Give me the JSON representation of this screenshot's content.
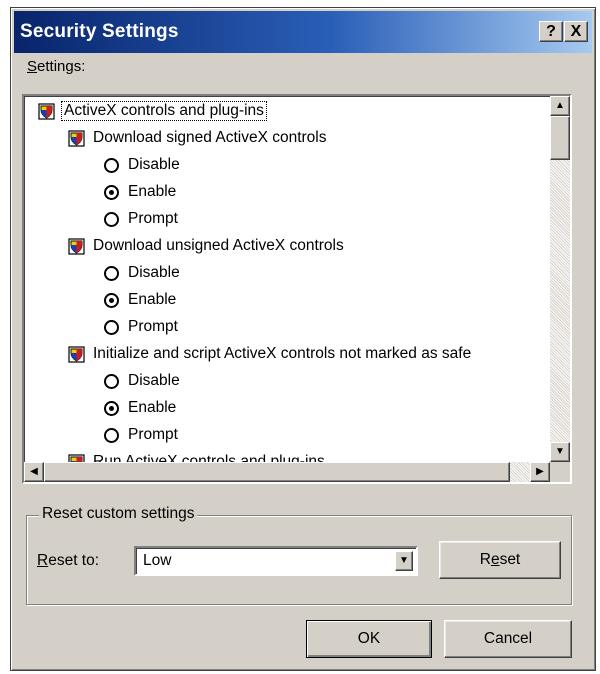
{
  "window": {
    "title": "Security Settings",
    "help_glyph": "?",
    "close_glyph": "X"
  },
  "settings_label_accel": "S",
  "settings_label_rest": "ettings:",
  "tree": {
    "category": "ActiveX controls and plug-ins",
    "items": [
      {
        "label": "Download signed ActiveX controls",
        "options": [
          {
            "label": "Disable",
            "selected": false
          },
          {
            "label": "Enable",
            "selected": true
          },
          {
            "label": "Prompt",
            "selected": false
          }
        ]
      },
      {
        "label": "Download unsigned ActiveX controls",
        "options": [
          {
            "label": "Disable",
            "selected": false
          },
          {
            "label": "Enable",
            "selected": true
          },
          {
            "label": "Prompt",
            "selected": false
          }
        ]
      },
      {
        "label": "Initialize and script ActiveX controls not marked as safe",
        "options": [
          {
            "label": "Disable",
            "selected": false
          },
          {
            "label": "Enable",
            "selected": true
          },
          {
            "label": "Prompt",
            "selected": false
          }
        ]
      },
      {
        "label": "Run ActiveX controls and plug-ins",
        "options": []
      }
    ]
  },
  "scroll_glyphs": {
    "up": "▲",
    "down": "▼",
    "left": "◀",
    "right": "▶"
  },
  "reset_group": {
    "title": "Reset custom settings",
    "reset_to_accel": "R",
    "reset_to_rest": "eset to:",
    "selected_level": "Low",
    "dropdown_glyph": "▼",
    "reset_button_pre": "R",
    "reset_button_accel": "e",
    "reset_button_post": "set"
  },
  "buttons": {
    "ok": "OK",
    "cancel": "Cancel"
  },
  "icons": {
    "setting_icon": "settings-doc-icon",
    "radio": "radio-button"
  }
}
